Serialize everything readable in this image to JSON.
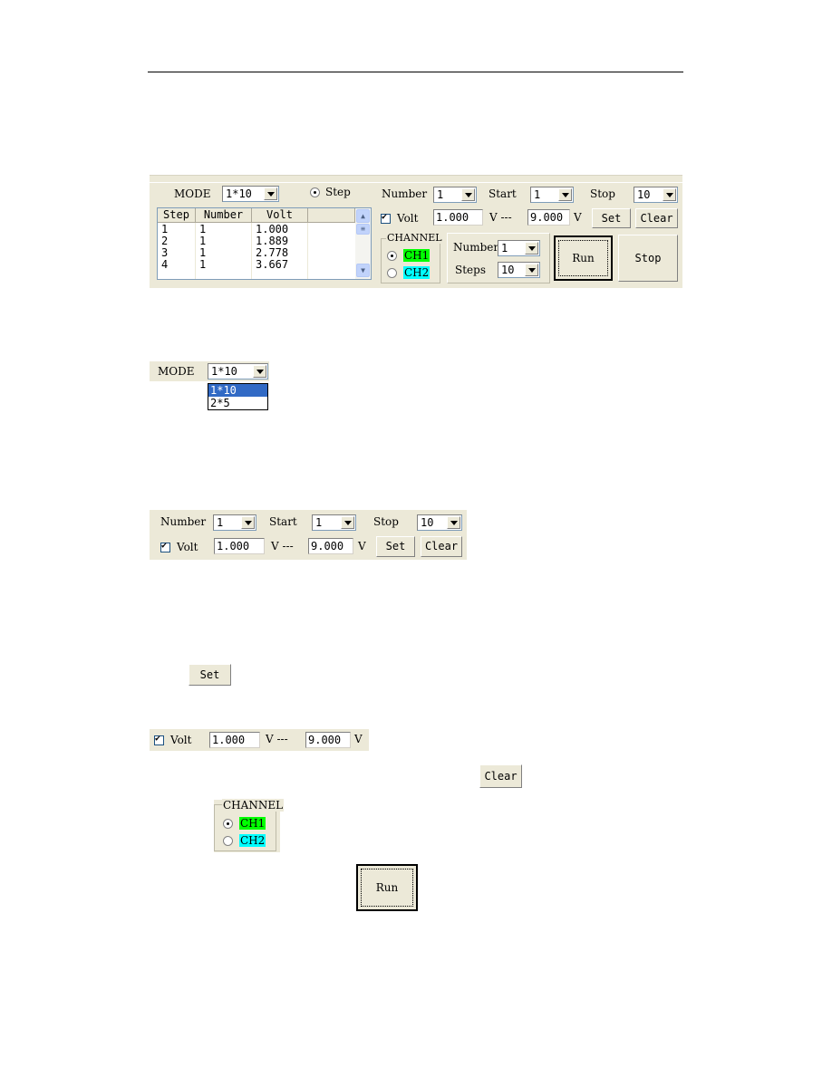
{
  "main_panel": {
    "mode_label": "MODE",
    "mode_value": "1*10",
    "step_radio_label": "Step",
    "number_label": "Number",
    "number_value": "1",
    "start_label": "Start",
    "start_value": "1",
    "stop_label": "Stop",
    "stop_value": "10",
    "volt_label": "Volt",
    "volt_checked": true,
    "volt_start": "1.000",
    "volt_unit_mid": "V ---",
    "volt_stop": "9.000",
    "volt_unit_end": "V",
    "set_button": "Set",
    "clear_button": "Clear",
    "channel_title": "CHANNEL",
    "ch1_label": "CH1",
    "ch2_label": "CH2",
    "ch1_color": "#00ff00",
    "ch2_color": "#00ffff",
    "selected_channel": "CH1",
    "steps_number_label": "Number",
    "steps_number_value": "1",
    "steps_label": "Steps",
    "steps_value": "10",
    "run_button": "Run",
    "stop_button": "Stop",
    "table": {
      "columns": [
        "Step",
        "Number",
        "Volt",
        ""
      ],
      "rows": [
        [
          "1",
          "1",
          "1.000"
        ],
        [
          "2",
          "1",
          "1.889"
        ],
        [
          "3",
          "1",
          "2.778"
        ],
        [
          "4",
          "1",
          "3.667"
        ]
      ]
    }
  },
  "mode_dropdown": {
    "label": "MODE",
    "value": "1*10",
    "options": [
      "1*10",
      "2*5"
    ],
    "selected": "1*10"
  },
  "param_panel": {
    "number_label": "Number",
    "number_value": "1",
    "start_label": "Start",
    "start_value": "1",
    "stop_label": "Stop",
    "stop_value": "10",
    "volt_label": "Volt",
    "volt_start": "1.000",
    "volt_unit_mid": "V ---",
    "volt_stop": "9.000",
    "volt_unit_end": "V",
    "set_button": "Set",
    "clear_button": "Clear"
  },
  "set_example": {
    "label": "Set"
  },
  "volt_example": {
    "label": "Volt",
    "volt_start": "1.000",
    "volt_unit_mid": "V ---",
    "volt_stop": "9.000",
    "volt_unit_end": "V"
  },
  "clear_example": {
    "label": "Clear"
  },
  "channel_example": {
    "title": "CHANNEL",
    "ch1_label": "CH1",
    "ch2_label": "CH2"
  },
  "run_example": {
    "label": "Run"
  }
}
